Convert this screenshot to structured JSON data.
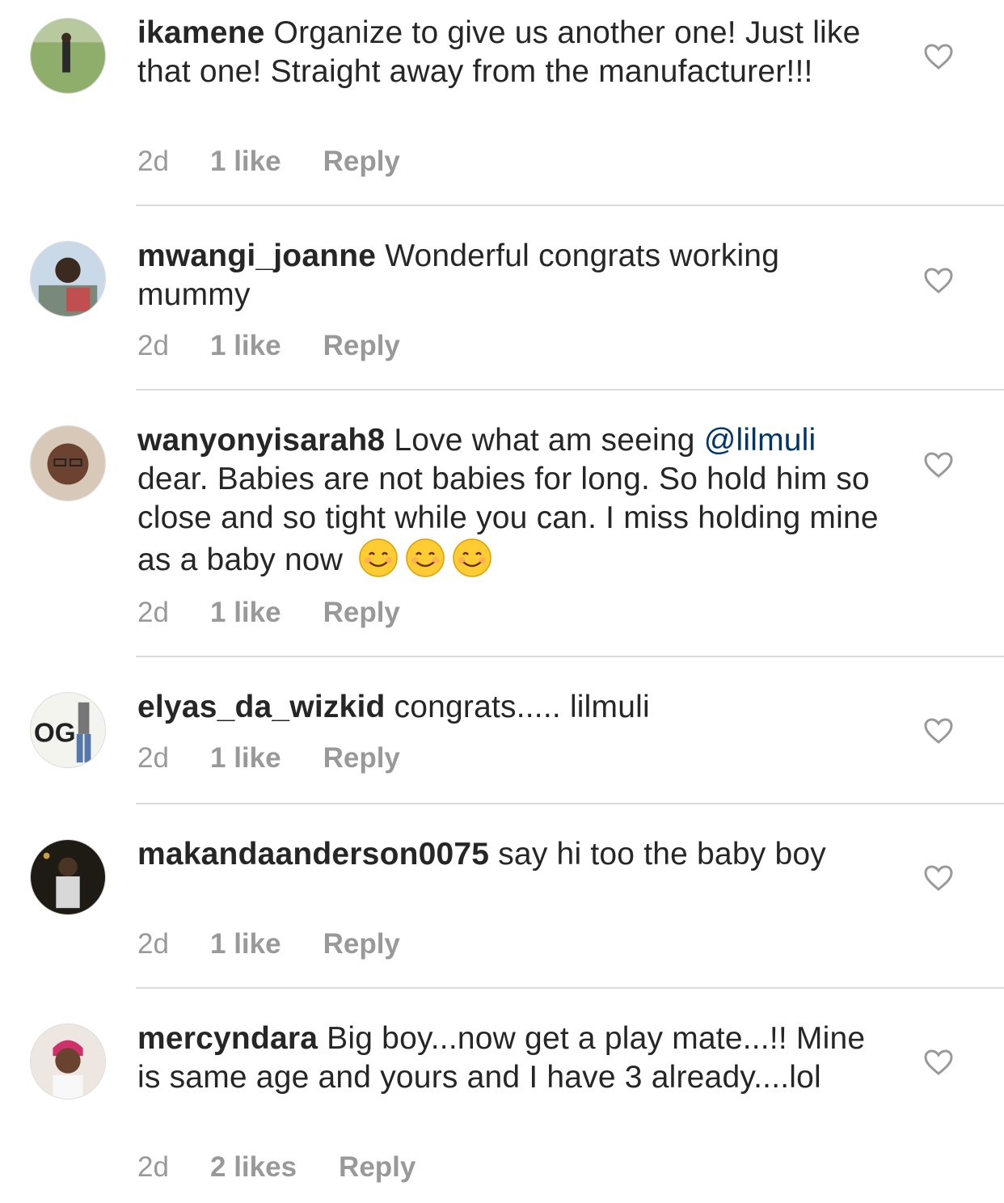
{
  "comments": [
    {
      "username": "ikamene",
      "text": " Organize to give us another one! Just like that one! Straight away from the manufacturer!!!",
      "time": "2d",
      "likes": "1 like",
      "reply": "Reply"
    },
    {
      "username": "mwangi_joanne",
      "text": " Wonderful congrats working mummy",
      "time": "2d",
      "likes": "1 like",
      "reply": "Reply"
    },
    {
      "username": "wanyonyisarah8",
      "text_before": " Love what am seeing ",
      "mention": "@lilmuli",
      "text_after": " dear. Babies are not babies for long. So hold him so close and so tight while you can. I miss holding mine as a baby now",
      "time": "2d",
      "likes": "1 like",
      "reply": "Reply"
    },
    {
      "username": "elyas_da_wizkid",
      "text": " congrats..... lilmuli",
      "time": "2d",
      "likes": "1 like",
      "reply": "Reply"
    },
    {
      "username": "makandaanderson0075",
      "text": " say hi too the baby boy",
      "time": "2d",
      "likes": "1 like",
      "reply": "Reply"
    },
    {
      "username": "mercyndara",
      "text": " Big boy...now get a play mate...!! Mine is same age and yours and I have 3 already....lol",
      "time": "2d",
      "likes": "2 likes",
      "reply": "Reply"
    }
  ],
  "avatar_4_text": "OG",
  "icons": {
    "like": "heart-outline-icon",
    "emoji": "smiling-face-emoji"
  },
  "colors": {
    "username": "#262626",
    "meta": "#999999",
    "mention": "#003569",
    "divider": "#dbdbdb"
  }
}
